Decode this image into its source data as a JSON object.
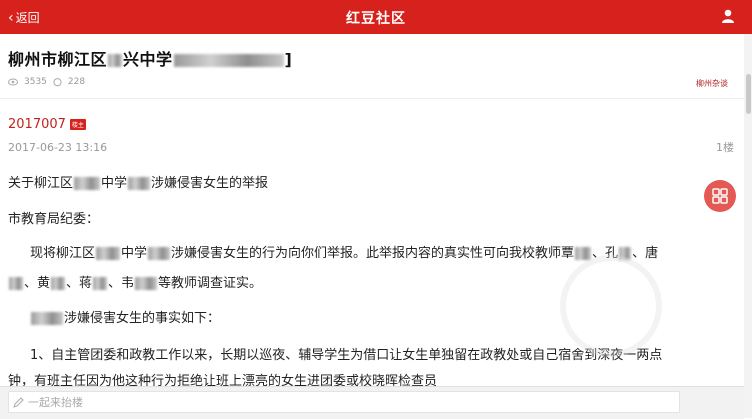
{
  "header": {
    "back_label": "返回",
    "title": "红豆社区"
  },
  "post": {
    "title_part1": "柳州市柳江区",
    "title_part2": "兴中学",
    "title_bracket_close": "]",
    "views": "3535",
    "comments": "228",
    "board": "柳州杂谈"
  },
  "reply": {
    "author": "2017007",
    "badge": "楼主",
    "date": "2017-06-23 13:16",
    "floor": "1楼",
    "line1_a": "关于柳江区",
    "line1_b": "中学",
    "line1_c": "涉嫌侵害女生的举报",
    "line2": "市教育局纪委：",
    "line3_a": "现将柳江区",
    "line3_b": "中学",
    "line3_c": "涉嫌侵害女生的行为向你们举报。此举报内容的真实性可向我校教师覃",
    "line3_d": "、孔",
    "line3_e": "、唐",
    "line4_a": "、黄",
    "line4_b": "、蒋",
    "line4_c": "、韦",
    "line4_d": "等教师调查证实。",
    "line5": "涉嫌侵害女生的事实如下：",
    "line6": "1、自主管团委和政教工作以来，长期以巡夜、辅导学生为借口让女生单独留在政教处或自己宿舍到深夜一两点",
    "line7": "钟，有班主任因为他这种行为拒绝让班上漂亮的女生进团委或校晓晖检查员"
  },
  "footer": {
    "reply_placeholder": "一起来抬楼"
  },
  "colors": {
    "accent": "#d7211c",
    "fab": "#e35a55"
  },
  "icons": {
    "back": "chevron-left-icon",
    "user": "user-icon",
    "eye": "eye-icon",
    "comment": "comment-icon",
    "fab": "grid-icon",
    "edit": "pencil-icon"
  }
}
